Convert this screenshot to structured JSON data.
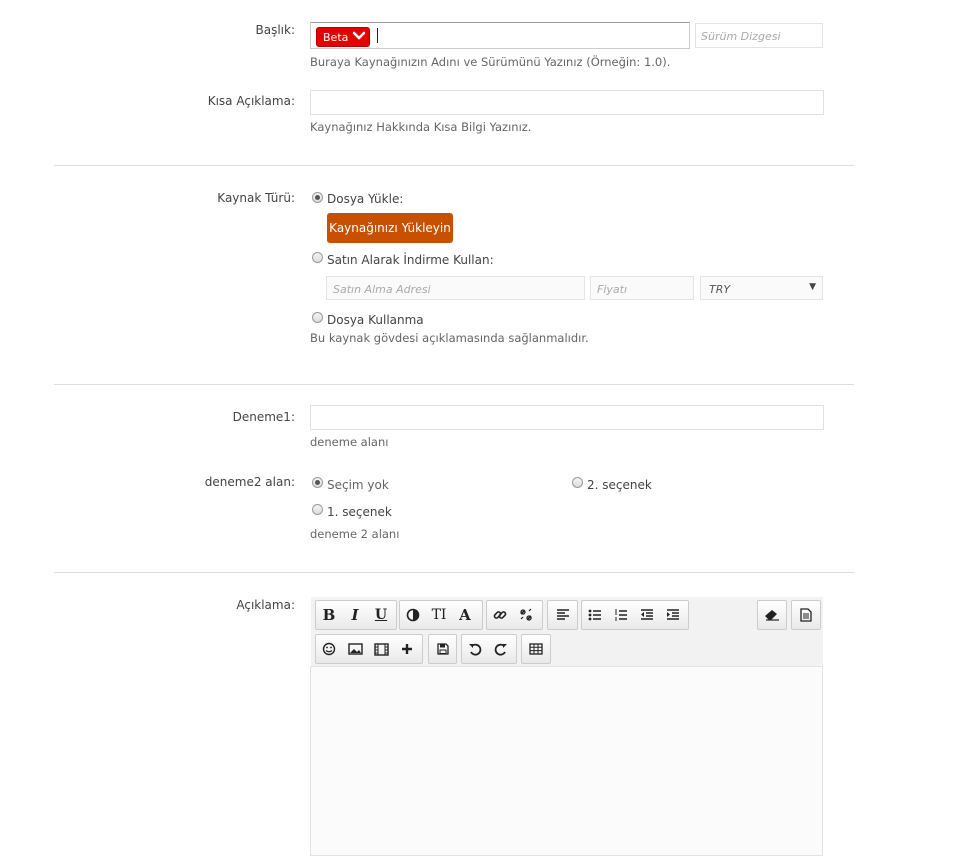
{
  "title_field": {
    "label": "Başlık:",
    "badge": "Beta",
    "version_placeholder": "Sürüm Dizgesi",
    "hint": "Buraya Kaynağınızın Adını ve Sürümünü Yazınız (Örneğin: 1.0)."
  },
  "short_desc": {
    "label": "Kısa Açıklama:",
    "hint": "Kaynağınız Hakkında Kısa Bilgi Yazınız."
  },
  "resource_type": {
    "label": "Kaynak Türü:",
    "option_upload": "Dosya Yükle:",
    "upload_button": "Kaynağınızı Yükleyin",
    "option_purchase": "Satın Alarak İndirme Kullan:",
    "purchase_url_placeholder": "Satın Alma Adresi",
    "price_placeholder": "Fiyatı",
    "currency_selected": "TRY",
    "option_no_file": "Dosya Kullanma",
    "no_file_hint": "Bu kaynak gövdesi açıklamasında sağlanmalıdır."
  },
  "deneme1": {
    "label": "Deneme1:",
    "hint": "deneme alanı"
  },
  "deneme2": {
    "label": "deneme2 alan:",
    "option_none": "Seçim yok",
    "option_2": "2. seçenek",
    "option_1": "1. seçenek",
    "hint": "deneme 2 alanı"
  },
  "description": {
    "label": "Açıklama:"
  },
  "editor_toolbar": {
    "bold": "B",
    "italic": "I",
    "underline": "U",
    "font_size": "TI",
    "font_family": "A",
    "icons": [
      "bold-icon",
      "italic-icon",
      "underline-icon",
      "color-icon",
      "font-size-icon",
      "font-family-icon",
      "link-icon",
      "unlink-icon",
      "align-icon",
      "bullet-list-icon",
      "numbered-list-icon",
      "outdent-icon",
      "indent-icon",
      "eraser-icon",
      "source-icon",
      "smiley-icon",
      "image-icon",
      "media-icon",
      "insert-icon",
      "save-draft-icon",
      "undo-icon",
      "redo-icon",
      "table-icon"
    ]
  },
  "colors": {
    "badge_red": "#e60000",
    "upload_button": "#c75100",
    "divider": "#dddddd"
  }
}
